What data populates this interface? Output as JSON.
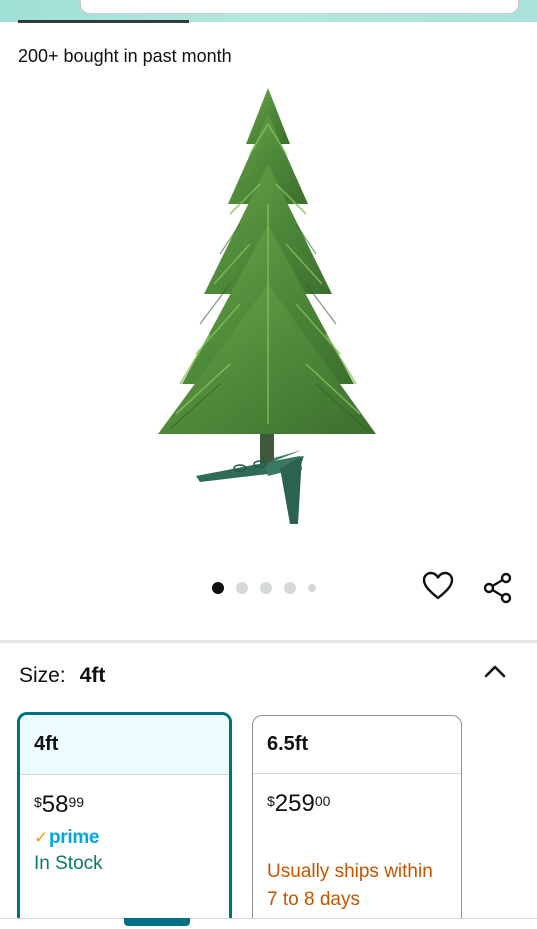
{
  "header": {
    "search_placeholder": ""
  },
  "social_proof": {
    "bought_text": "200+ bought in past month"
  },
  "gallery": {
    "image_alt": "4ft artificial Christmas tree on green stand",
    "image_count": 5,
    "active_index": 0
  },
  "actions": {
    "wishlist_icon": "heart-outline-icon",
    "share_icon": "share-icon"
  },
  "size_selector": {
    "label": "Size:",
    "selected_value": "4ft",
    "expanded": true,
    "options": [
      {
        "name": "4ft",
        "currency": "$",
        "price_whole": "58",
        "price_fraction": "99",
        "prime_label": "prime",
        "availability": "In Stock",
        "selected": true
      },
      {
        "name": "6.5ft",
        "currency": "$",
        "price_whole": "259",
        "price_fraction": "00",
        "availability_line1": "Usually ships within",
        "availability_line2": "7 to 8 days",
        "selected": false
      }
    ]
  },
  "colors": {
    "accent_teal": "#007185",
    "selected_card_header_bg": "#edfdff",
    "in_stock_green": "#067d62",
    "ships_orange": "#c45500",
    "prime_blue": "#00a8e1",
    "prime_check": "#f49b0b"
  }
}
